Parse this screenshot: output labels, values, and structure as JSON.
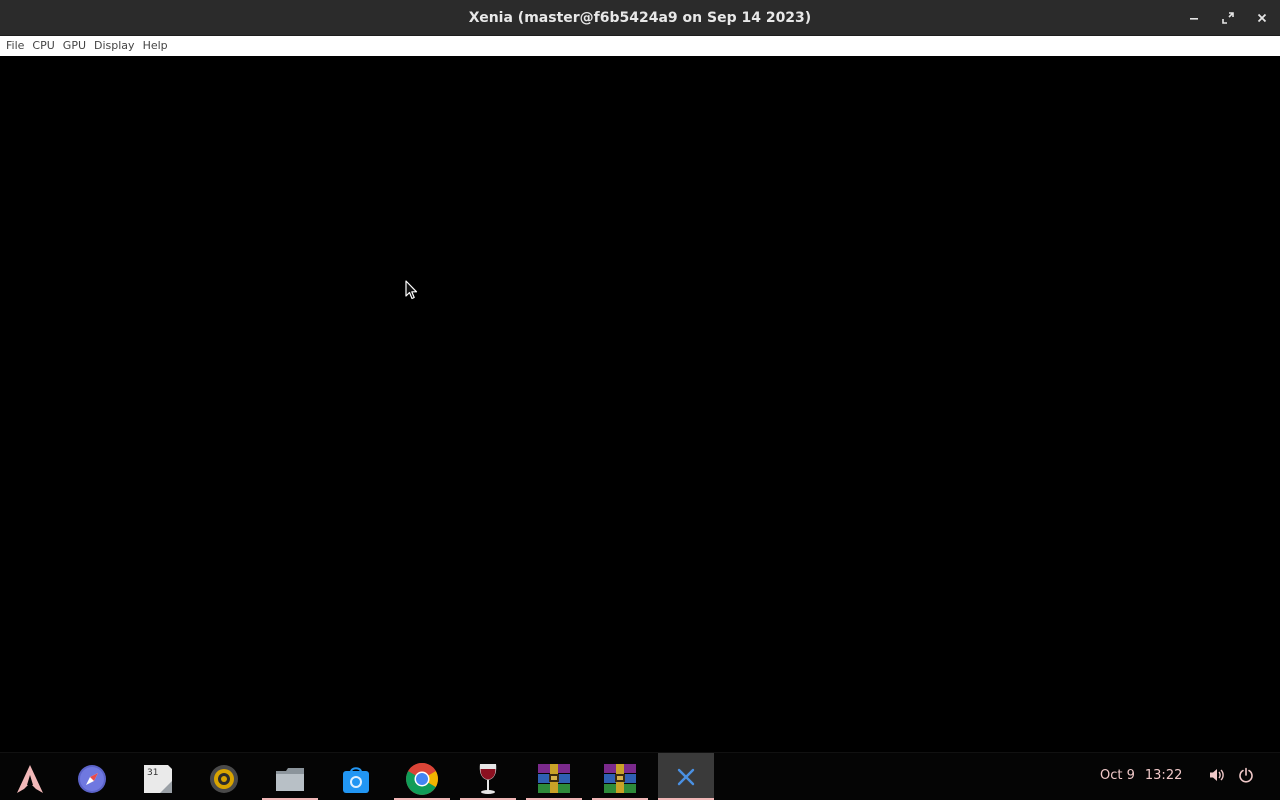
{
  "window": {
    "title": "Xenia (master@f6b5424a9 on Sep 14 2023)",
    "controls": {
      "minimize_icon": "minimize-icon",
      "maximize_icon": "restore-icon",
      "close_icon": "close-icon"
    }
  },
  "menubar": {
    "items": [
      {
        "label": "File"
      },
      {
        "label": "CPU"
      },
      {
        "label": "GPU"
      },
      {
        "label": "Display"
      },
      {
        "label": "Help"
      }
    ]
  },
  "taskbar": {
    "apps": [
      {
        "name": "arch-launcher-icon",
        "running": false
      },
      {
        "name": "compass-browser-icon",
        "running": false
      },
      {
        "name": "calendar-icon",
        "running": false,
        "badge": "31"
      },
      {
        "name": "speaker-app-icon",
        "running": false
      },
      {
        "name": "files-icon",
        "running": true
      },
      {
        "name": "store-icon",
        "running": false
      },
      {
        "name": "chrome-icon",
        "running": true
      },
      {
        "name": "wine-icon",
        "running": true
      },
      {
        "name": "winrar-icon",
        "running": true
      },
      {
        "name": "winrar-icon",
        "running": true
      },
      {
        "name": "xenia-icon",
        "running": true,
        "active": true
      }
    ],
    "clock": {
      "date": "Oct 9",
      "time": "13:22"
    },
    "tray": {
      "volume_icon": "volume-icon",
      "power_icon": "power-icon"
    }
  },
  "colors": {
    "titlebar": "#2b2b2b",
    "menubar": "#ffffff",
    "render_bg": "#000000",
    "taskbar": "#050505",
    "running_indicator": "#f0b6b6",
    "clock_text": "#f1c9c9"
  }
}
